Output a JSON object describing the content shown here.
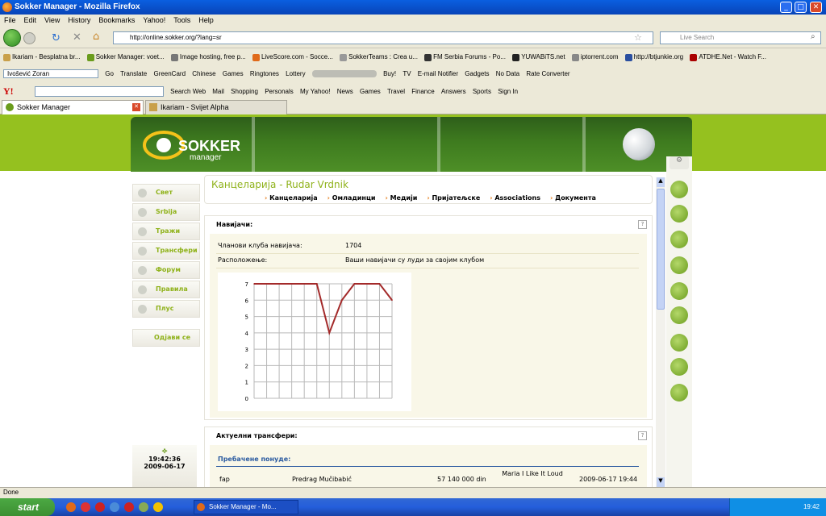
{
  "window": {
    "title": "Sokker Manager - Mozilla Firefox",
    "min": "_",
    "max": "□",
    "close": "✕"
  },
  "menu": [
    "File",
    "Edit",
    "View",
    "History",
    "Bookmarks",
    "Yahoo!",
    "Tools",
    "Help"
  ],
  "nav": {
    "url": "http://online.sokker.org/?lang=sr",
    "search_placeholder": "Live Search"
  },
  "bookmarks": [
    "Ikariam - Besplatna br...",
    "Sokker Manager: voet...",
    "Image hosting, free p...",
    "LiveScore.com - Socce...",
    "SokkerTeams : Crea u...",
    "FM Serbia Forums - Po...",
    "YUWABiTS.net",
    "iptorrent.com",
    "http://btjunkie.org",
    "ATDHE.Net - Watch F..."
  ],
  "toolbar2": [
    "Ivošević Zoran",
    "Go",
    "Translate",
    "GreenCard",
    "Chinese",
    "Games",
    "Ringtones",
    "Lottery",
    "Buy!",
    "TV",
    "E-mail Notifier",
    "Gadgets",
    "No Data",
    "Rate Converter"
  ],
  "toolbar3": [
    "Search Web",
    "Mail",
    "Shopping",
    "Personals",
    "My Yahoo!",
    "News",
    "Games",
    "Travel",
    "Finance",
    "Answers",
    "Sports",
    "Sign In"
  ],
  "tabs": [
    {
      "label": "Sokker Manager",
      "active": true
    },
    {
      "label": "Ikariam - Svijet Alpha",
      "active": false
    }
  ],
  "site": {
    "logo_top": "SOKKER",
    "logo_bottom": "manager",
    "sidebar": [
      "Свет",
      "Srbija",
      "Тражи",
      "Трансфери",
      "Форум",
      "Правила",
      "Плус"
    ],
    "logout": "Одјави се",
    "clock": {
      "time": "19:42:36",
      "date": "2009-06-17"
    },
    "office_title": "Канцеларија - Rudar Vrdnik",
    "subnav": [
      "Канцеларија",
      "Омладинци",
      "Медији",
      "Пријатељске",
      "Associations",
      "Документа"
    ],
    "fans": {
      "header": "Навијачи:",
      "members_label": "Чланови клуба навијача:",
      "members_value": "1704",
      "mood_label": "Расположење:",
      "mood_value": "Ваши навијачи су луди за својим клубом"
    },
    "transfers": {
      "header": "Актуелни трансфери:",
      "sub_header": "Пребачене понуде:",
      "rows": [
        {
          "buyer": "fap",
          "player": "Predrag Mučibabić",
          "amount": "57 140 000 din",
          "club": "Maria I Like It Loud",
          "date": "2009-06-17 19:44"
        }
      ]
    }
  },
  "chart_data": {
    "type": "line",
    "title": "",
    "xlabel": "",
    "ylabel": "",
    "ylim": [
      0,
      7
    ],
    "yticks": [
      "0",
      "1",
      "2",
      "3",
      "4",
      "5",
      "6",
      "7"
    ],
    "x": [
      0,
      1,
      2,
      3,
      4,
      5,
      6,
      7,
      8,
      9,
      10,
      11
    ],
    "values": [
      7,
      7,
      7,
      7,
      7,
      7,
      4,
      6,
      7,
      7,
      7,
      6
    ],
    "grid": true,
    "color": "#a32a2a"
  },
  "status": "Done",
  "taskbar": {
    "start": "start",
    "window_btn": "Sokker Manager - Mo...",
    "time": "19:42"
  }
}
